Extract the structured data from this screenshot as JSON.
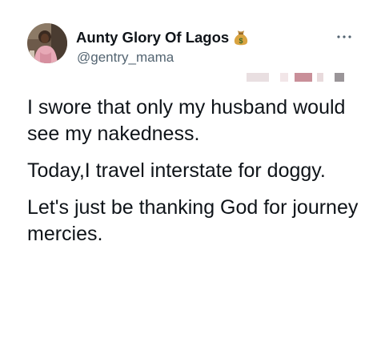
{
  "tweet": {
    "author": {
      "display_name": "Aunty Glory Of Lagos",
      "handle": "@gentry_mama",
      "badge_icon": "money-bag-icon",
      "menu_icon": "more-options-icon"
    },
    "paragraphs": [
      "I swore that only my husband would see my nakedness.",
      "Today,I travel interstate for doggy.",
      "Let's just be thanking God for journey mercies."
    ]
  }
}
